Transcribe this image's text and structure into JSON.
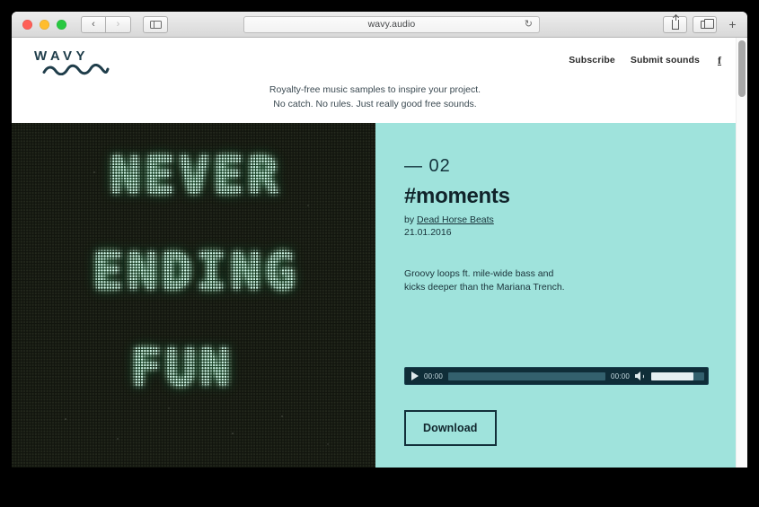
{
  "browser": {
    "url": "wavy.audio",
    "reload_icon": "reload-icon",
    "back_icon": "‹",
    "forward_icon": "›",
    "sidebar_icon": "sidebar-icon",
    "share_icon": "share-icon",
    "tabs_icon": "tabs-icon",
    "new_tab_icon": "+"
  },
  "site": {
    "logo_word": "WAVY",
    "nav": [
      {
        "label": "Subscribe"
      },
      {
        "label": "Submit sounds"
      }
    ],
    "facebook_icon": "f",
    "tagline_line1": "Royalty-free music samples to inspire your project.",
    "tagline_line2": "No catch. No rules. Just really good free sounds."
  },
  "artwork": {
    "line1": "NEVER",
    "line2": "ENDING",
    "line3": "FUN",
    "bg_color": "#13160f",
    "glow_color": "#bff7e2"
  },
  "track": {
    "number": "— 02",
    "title": "#moments",
    "by_prefix": "by ",
    "artist": "Dead Horse Beats",
    "date": "21.01.2016",
    "description_line1": "Groovy loops ft. mile-wide bass and",
    "description_line2": "kicks deeper than the Mariana Trench.",
    "panel_color": "#9fe3dc"
  },
  "player": {
    "play_icon": "play-icon",
    "current_time": "00:00",
    "duration": "00:00",
    "speaker_icon": "speaker-icon"
  },
  "actions": {
    "download_label": "Download"
  }
}
